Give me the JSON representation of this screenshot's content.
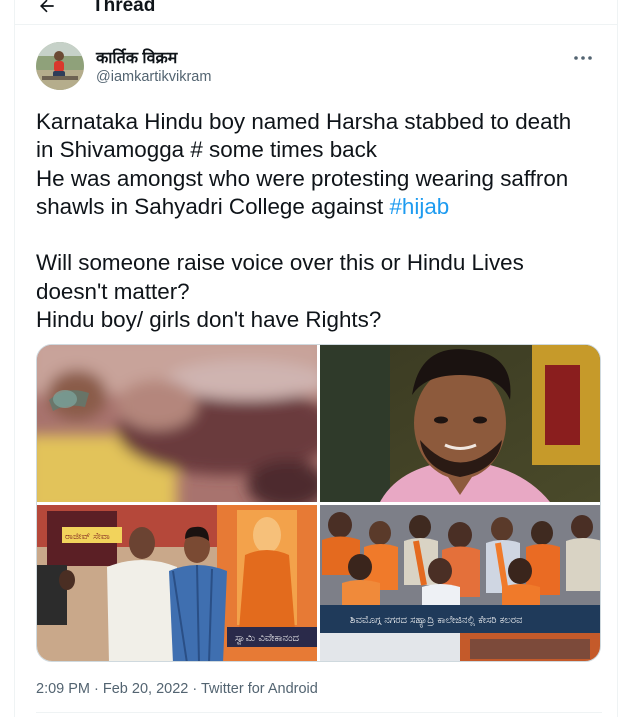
{
  "header": {
    "back_icon": "arrow-left-icon",
    "title": "Thread"
  },
  "author": {
    "display_name": "कार्तिक विक्रम",
    "handle": "@iamkartikvikram"
  },
  "tweet": {
    "lines": [
      "Karnataka Hindu boy named Harsha stabbed to death",
      "in Shivamogga # some times back",
      "He was amongst who were protesting wearing saffron"
    ],
    "line4_prefix": "shawls in Sahyadri College against ",
    "hashtag": "#hijab",
    "lines_after": [
      "Will someone raise voice over this or Hindu Lives",
      "doesn't matter?",
      "Hindu boy/ girls don't have Rights?"
    ]
  },
  "media": {
    "count": 4,
    "banner_text": "ಶಿವಮೊಗ್ಗ ನಗರದ ಸಹ್ಯಾದ್ರಿ ಕಾಲೇಜಿನಲ್ಲಿ ಕೇಸರಿ ಕಲರವ",
    "photo3_sign_text": "ರಾಜೀವ್ ಸೇವಾ",
    "photo3_poster_text": "ಸ್ವಾಮಿ ವಿವೇಕಾನಂದ"
  },
  "meta": {
    "time": "2:09 PM",
    "separator": " · ",
    "date": "Feb 20, 2022",
    "source": "Twitter for Android"
  },
  "colors": {
    "text": "#0f1419",
    "muted": "#536471",
    "link": "#1d9bf0",
    "border": "#eff3f4"
  }
}
